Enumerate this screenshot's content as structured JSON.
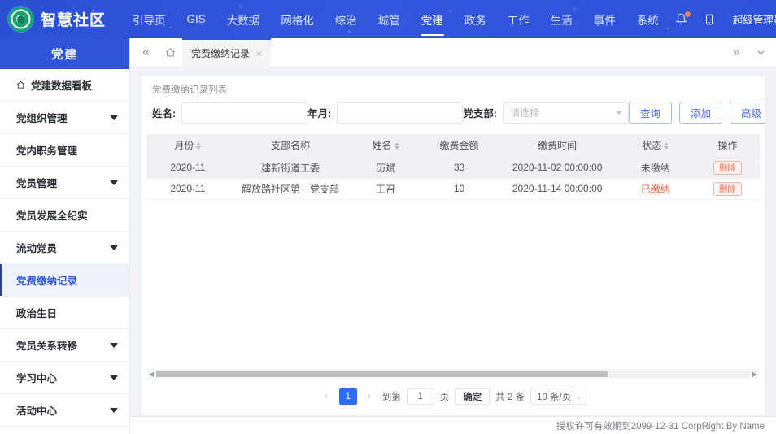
{
  "header": {
    "brand_title": "智慧社区",
    "logo_icon": "community-logo-icon",
    "nav": [
      {
        "label": "引导页",
        "active": false
      },
      {
        "label": "GIS",
        "active": false
      },
      {
        "label": "大数据",
        "active": false
      },
      {
        "label": "网格化",
        "active": false
      },
      {
        "label": "综治",
        "active": false
      },
      {
        "label": "城管",
        "active": false
      },
      {
        "label": "党建",
        "active": true
      },
      {
        "label": "政务",
        "active": false
      },
      {
        "label": "工作",
        "active": false
      },
      {
        "label": "生活",
        "active": false
      },
      {
        "label": "事件",
        "active": false
      },
      {
        "label": "系统",
        "active": false
      }
    ],
    "bell_icon": "bell-icon",
    "phone_icon": "mobile-phone-icon",
    "user_name": "超级管理员",
    "more_icon": "more-vertical-icon",
    "brand_color": "#2f54d6",
    "badge_color": "#ff7a45"
  },
  "sidebar": {
    "title": "党建",
    "items": [
      {
        "label": "党建数据看板",
        "icon": "home-icon",
        "expandable": false,
        "active": false
      },
      {
        "label": "党组织管理",
        "icon": "",
        "expandable": true,
        "active": false
      },
      {
        "label": "党内职务管理",
        "icon": "",
        "expandable": false,
        "active": false
      },
      {
        "label": "党员管理",
        "icon": "",
        "expandable": true,
        "active": false
      },
      {
        "label": "党员发展全纪实",
        "icon": "",
        "expandable": false,
        "active": false
      },
      {
        "label": "流动党员",
        "icon": "",
        "expandable": true,
        "active": false
      },
      {
        "label": "党费缴纳记录",
        "icon": "",
        "expandable": false,
        "active": true
      },
      {
        "label": "政治生日",
        "icon": "",
        "expandable": false,
        "active": false
      },
      {
        "label": "党员关系转移",
        "icon": "",
        "expandable": true,
        "active": false
      },
      {
        "label": "学习中心",
        "icon": "",
        "expandable": true,
        "active": false
      },
      {
        "label": "活动中心",
        "icon": "",
        "expandable": true,
        "active": false
      }
    ],
    "active_text_color": "#2f54d6"
  },
  "tabbar": {
    "collapse_icon": "double-chevron-left-icon",
    "home_icon": "home-icon",
    "tabs": [
      {
        "label": "党费缴纳记录",
        "active": true,
        "closable": true
      }
    ],
    "close_glyph": "×",
    "expand_icon": "double-chevron-right-icon",
    "dropdown_icon": "chevron-down-icon"
  },
  "panel": {
    "title": "党费缴纳记录列表",
    "filters": {
      "name_label": "姓名:",
      "name_value": "",
      "name_placeholder": "",
      "yearmonth_label": "年月:",
      "yearmonth_value": "",
      "yearmonth_placeholder": "",
      "branch_label": "党支部:",
      "branch_value": "请选择"
    },
    "buttons": {
      "query": "查询",
      "add": "添加",
      "advanced": "高级"
    },
    "table": {
      "columns": [
        {
          "label": "月份",
          "sortable": true
        },
        {
          "label": "支部名称",
          "sortable": false
        },
        {
          "label": "姓名",
          "sortable": true
        },
        {
          "label": "缴费金额",
          "sortable": false
        },
        {
          "label": "缴费时间",
          "sortable": false
        },
        {
          "label": "状态",
          "sortable": true
        },
        {
          "label": "操作",
          "sortable": false
        }
      ],
      "rows": [
        {
          "month": "2020-11",
          "branch": "建新街道工委",
          "name": "历斌",
          "amount": "33",
          "time": "2020-11-02 00:00:00",
          "status": "未缴纳",
          "status_state": "unpaid",
          "action": "删除"
        },
        {
          "month": "2020-11",
          "branch": "解放路社区第一党支部",
          "name": "王召",
          "amount": "10",
          "time": "2020-11-14 00:00:00",
          "status": "已缴纳",
          "status_state": "paid",
          "action": "删除"
        }
      ]
    },
    "pagination": {
      "prev_glyph": "‹",
      "next_glyph": "›",
      "current_page": "1",
      "goto_label": "到第",
      "goto_value": "1",
      "page_unit": "页",
      "confirm": "确定",
      "total_text": "共 2 条",
      "page_size": "10 条/页",
      "page_size_caret": "⌄"
    }
  },
  "footer": {
    "text": "授权许可有效期到2099-12-31 CorpRight By Name"
  }
}
